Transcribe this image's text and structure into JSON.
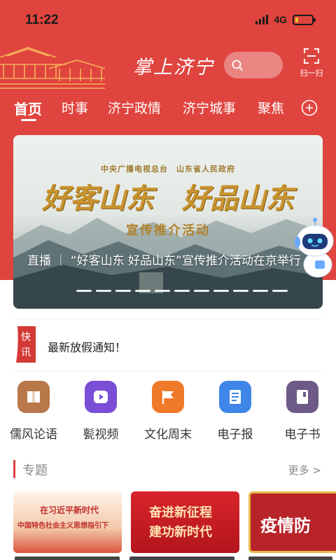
{
  "status_bar": {
    "time": "11:22",
    "network": "4G",
    "battery_level": 0.2
  },
  "header": {
    "title": "掌上济宁",
    "scan_label": "扫一扫"
  },
  "tabs": [
    "首页",
    "时事",
    "济宁政情",
    "济宁城事",
    "聚焦"
  ],
  "active_tab": 0,
  "banner": {
    "org_line": "中央广播电视总台　山东省人民政府",
    "slogan": "好客山东　好品山东",
    "subtitle": "宣传推介活动",
    "caption": "直播 ｜ “好客山东 好品山东”宣传推介活动在京举行",
    "slide_count": 11
  },
  "news_flash": {
    "badge_top": "快",
    "badge_bottom": "讯",
    "text": "最新放假通知！"
  },
  "shortcuts": [
    {
      "label": "儒风论语",
      "icon": "book-icon",
      "color": "#b8784a"
    },
    {
      "label": "甏视频",
      "icon": "play-icon",
      "color": "#7a4fd6"
    },
    {
      "label": "文化周末",
      "icon": "flag-icon",
      "color": "#f07a2a"
    },
    {
      "label": "电子报",
      "icon": "newspaper-icon",
      "color": "#3f86e8"
    },
    {
      "label": "电子书",
      "icon": "ebook-icon",
      "color": "#6e5a86"
    }
  ],
  "section": {
    "title": "专题",
    "more": "更多 >"
  },
  "topics": [
    {
      "line1": "在习近平新时代",
      "line2": "中国特色社会主义思想指引下"
    },
    {
      "line1": "奋进新征程",
      "line2": "建功新时代"
    },
    {
      "line1": "疫情防"
    }
  ],
  "colors": {
    "brand_red": "#e0443f",
    "gold": "#c8932e"
  }
}
